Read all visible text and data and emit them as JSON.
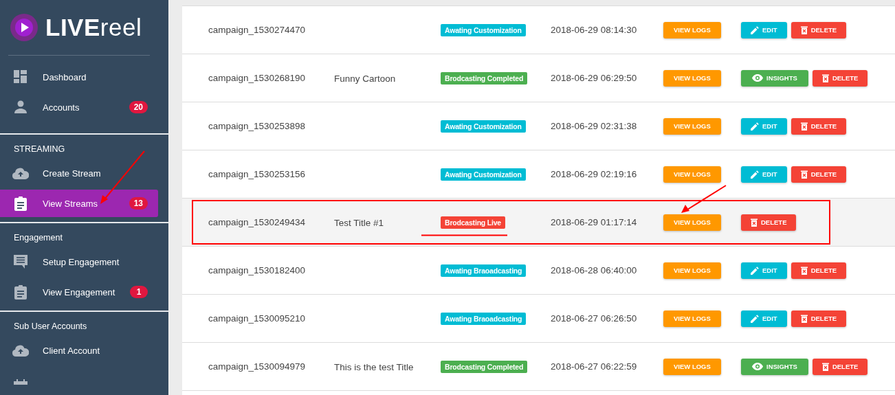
{
  "logo": {
    "text": "**LIVE**reel"
  },
  "sidebar": {
    "sections": [
      {
        "items": [
          {
            "label": "Dashboard",
            "selected": false
          },
          {
            "label": "Accounts",
            "badge": "20",
            "selected": false
          }
        ]
      },
      {
        "heading": "STREAMING",
        "items": [
          {
            "label": "Create Stream",
            "selected": false
          },
          {
            "label": "View Streams",
            "badge": "13",
            "selected": true
          }
        ]
      },
      {
        "heading": "Engagement",
        "items": [
          {
            "label": "Setup Engagement",
            "selected": false
          },
          {
            "label": "View Engagement",
            "badge": "1",
            "selected": false
          }
        ]
      },
      {
        "heading": "Sub User Accounts",
        "items": [
          {
            "label": "Client Account",
            "selected": false
          }
        ]
      }
    ]
  },
  "table": {
    "rows": [
      {
        "campaign": "campaign_1530274470",
        "status": {
          "label": "Awating Customization",
          "color": "#00bcd4"
        },
        "date": "2018-06-29 08:14:30",
        "view_logs": "VIEW LOGS",
        "actions": [
          {
            "kind": "edit",
            "label": "EDIT"
          },
          {
            "kind": "delete",
            "label": "DELETE"
          }
        ],
        "selected": false
      },
      {
        "campaign": "campaign_1530268190",
        "title": "Funny Cartoon",
        "status": {
          "label": "Brodcasting Completed",
          "color": "#4caf50"
        },
        "date": "2018-06-29 06:29:50",
        "view_logs": "VIEW LOGS",
        "actions": [
          {
            "kind": "insights",
            "label": "INSIGHTS"
          },
          {
            "kind": "delete",
            "label": "DELETE"
          }
        ],
        "selected": false
      },
      {
        "campaign": "campaign_1530253898",
        "status": {
          "label": "Awating Customization",
          "color": "#00bcd4"
        },
        "date": "2018-06-29 02:31:38",
        "view_logs": "VIEW LOGS",
        "actions": [
          {
            "kind": "edit",
            "label": "EDIT"
          },
          {
            "kind": "delete",
            "label": "DELETE"
          }
        ],
        "selected": false
      },
      {
        "campaign": "campaign_1530253156",
        "status": {
          "label": "Awating Customization",
          "color": "#00bcd4"
        },
        "date": "2018-06-29 02:19:16",
        "view_logs": "VIEW LOGS",
        "actions": [
          {
            "kind": "edit",
            "label": "EDIT"
          },
          {
            "kind": "delete",
            "label": "DELETE"
          }
        ],
        "selected": false
      },
      {
        "campaign": "campaign_1530249434",
        "title": "Test Title #1",
        "status": {
          "label": "Brodcasting Live",
          "color": "#f44336"
        },
        "date": "2018-06-29 01:17:14",
        "view_logs": "VIEW LOGS",
        "actions": [
          {
            "kind": "delete",
            "label": "DELETE"
          }
        ],
        "selected": true
      },
      {
        "campaign": "campaign_1530182400",
        "status": {
          "label": "Awating Braoadcasting",
          "color": "#00bcd4"
        },
        "date": "2018-06-28 06:40:00",
        "view_logs": "VIEW LOGS",
        "actions": [
          {
            "kind": "edit",
            "label": "EDIT"
          },
          {
            "kind": "delete",
            "label": "DELETE"
          }
        ],
        "selected": false
      },
      {
        "campaign": "campaign_1530095210",
        "status": {
          "label": "Awating Braoadcasting",
          "color": "#00bcd4"
        },
        "date": "2018-06-27 06:26:50",
        "view_logs": "VIEW LOGS",
        "actions": [
          {
            "kind": "edit",
            "label": "EDIT"
          },
          {
            "kind": "delete",
            "label": "DELETE"
          }
        ],
        "selected": false
      },
      {
        "campaign": "campaign_1530094979",
        "title": "This is the test Title",
        "status": {
          "label": "Brodcasting Completed",
          "color": "#4caf50"
        },
        "date": "2018-06-27 06:22:59",
        "view_logs": "VIEW LOGS",
        "actions": [
          {
            "kind": "insights",
            "label": "INSIGHTS"
          },
          {
            "kind": "delete",
            "label": "DELETE"
          }
        ],
        "selected": false
      }
    ]
  }
}
